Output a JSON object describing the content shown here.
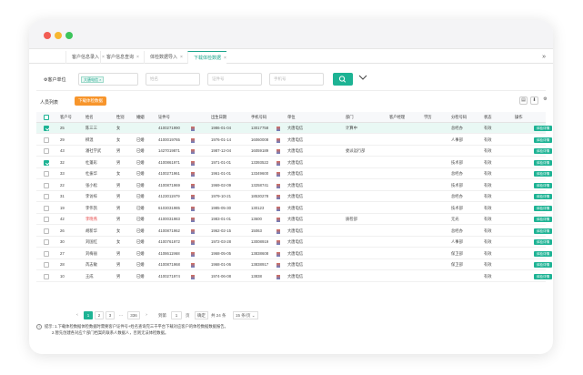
{
  "tabs": [
    "客户信息录入",
    "客户信息查询",
    "体检数据导入",
    "下载体检数据"
  ],
  "active_tab": 3,
  "more_icon": "»",
  "filter": {
    "label": "客户单位",
    "chip": "大唐电信",
    "placeholders": [
      "姓名",
      "证件号",
      "手机号"
    ]
  },
  "toolbar": {
    "title": "人员列表",
    "button": "下载体检数据"
  },
  "columns": [
    "客户号",
    "姓名",
    "性别",
    "婚姻",
    "证件号",
    "出生日期",
    "手机号码",
    "单位",
    "部门",
    "客户经理",
    "学历",
    "分检号码",
    "状态",
    "操作"
  ],
  "rows": [
    {
      "checked": true,
      "sel": true,
      "no": "25",
      "name": "陈三三",
      "sex": "女",
      "mar": "",
      "id": "4100271990",
      "idtail": "YBL",
      "birth": "1986-01-04",
      "phone": "13017758",
      "unit": "大唐电信",
      "dept": "计算中",
      "ctm": "",
      "edu": "",
      "split": "总经办",
      "status": "有效",
      "op": "体检详情"
    },
    {
      "checked": false,
      "sel": false,
      "no": "29",
      "name": "柳温",
      "sex": "女",
      "mar": "已婚",
      "id": "4100019765",
      "idtail": "",
      "birth": "1976-01-14",
      "phone": "16060008",
      "unit": "大唐电信",
      "dept": "",
      "ctm": "",
      "edu": "",
      "split": "人事部",
      "status": "有效",
      "op": "体检详情"
    },
    {
      "checked": false,
      "sel": false,
      "no": "43",
      "name": "潘社学武",
      "sex": "男",
      "mar": "已婚",
      "id": "1427019871",
      "idtail": "",
      "birth": "1987-12-04",
      "phone": "16059189",
      "unit": "大唐电信",
      "dept": "委派运行部",
      "ctm": "",
      "edu": "",
      "split": "",
      "status": "有效",
      "op": "体检详情"
    },
    {
      "checked": true,
      "sel": false,
      "no": "32",
      "name": "杜蓬彩",
      "sex": "男",
      "mar": "已婚",
      "id": "4100861971",
      "idtail": "",
      "birth": "1971-01-01",
      "phone": "13393522",
      "unit": "大唐电信",
      "dept": "",
      "ctm": "",
      "edu": "",
      "split": "技术部",
      "status": "有效",
      "op": "体检详情"
    },
    {
      "checked": false,
      "sel": false,
      "no": "33",
      "name": "杜振华",
      "sex": "女",
      "mar": "已婚",
      "id": "4100271961",
      "idtail": "",
      "birth": "1961-01-01",
      "phone": "13349600",
      "unit": "大唐电信",
      "dept": "",
      "ctm": "",
      "edu": "",
      "split": "总经办",
      "status": "有效",
      "op": "体检详情"
    },
    {
      "checked": false,
      "sel": false,
      "no": "22",
      "name": "张小松",
      "sex": "男",
      "mar": "已婚",
      "id": "4100871969",
      "idtail": "",
      "birth": "1969-02-09",
      "phone": "13258741",
      "unit": "大唐电信",
      "dept": "",
      "ctm": "",
      "edu": "",
      "split": "技术部",
      "status": "有效",
      "op": "体检详情"
    },
    {
      "checked": false,
      "sel": false,
      "no": "31",
      "name": "李访梓",
      "sex": "男",
      "mar": "已婚",
      "id": "4123011979",
      "idtail": "",
      "birth": "1979-10-21",
      "phone": "18530278",
      "unit": "大唐电信",
      "dept": "",
      "ctm": "",
      "edu": "",
      "split": "总经办",
      "status": "有效",
      "op": "体检详情"
    },
    {
      "checked": false,
      "sel": false,
      "no": "19",
      "name": "李伟凯",
      "sex": "男",
      "mar": "已婚",
      "id": "6103031985",
      "idtail": "",
      "birth": "1985-05-30",
      "phone": "130123",
      "unit": "大唐电信",
      "dept": "",
      "ctm": "",
      "edu": "",
      "split": "技术部",
      "status": "有效",
      "op": "体检详情"
    },
    {
      "checked": false,
      "sel": false,
      "no": "42",
      "name": "李晓燕",
      "sex": "男",
      "mar": "已婚",
      "id": "4100031983",
      "idtail": "",
      "birth": "1983-01-01",
      "phone": "13600",
      "unit": "大唐电信",
      "dept": "质检部",
      "ctm": "",
      "edu": "",
      "split": "无光",
      "status": "有效",
      "op": "体检详情",
      "red": true
    },
    {
      "checked": false,
      "sel": false,
      "no": "26",
      "name": "胡新华",
      "sex": "女",
      "mar": "已婚",
      "id": "4100871962",
      "idtail": "",
      "birth": "1962-02-15",
      "phone": "15063",
      "unit": "大唐电信",
      "dept": "",
      "ctm": "",
      "edu": "",
      "split": "总经办",
      "status": "有效",
      "op": "体检详情"
    },
    {
      "checked": false,
      "sel": false,
      "no": "30",
      "name": "刘国红",
      "sex": "女",
      "mar": "已婚",
      "id": "4100761972",
      "idtail": "",
      "birth": "1972-03-28",
      "phone": "13008919",
      "unit": "大唐电信",
      "dept": "",
      "ctm": "",
      "edu": "",
      "split": "人事部",
      "status": "有效",
      "op": "体检详情"
    },
    {
      "checked": false,
      "sel": false,
      "no": "27",
      "name": "刘梅丽",
      "sex": "男",
      "mar": "已婚",
      "id": "4108611968",
      "idtail": "",
      "birth": "1968-05-05",
      "phone": "13838608",
      "unit": "大唐电信",
      "dept": "",
      "ctm": "",
      "edu": "",
      "split": "保卫部",
      "status": "有效",
      "op": "体检详情"
    },
    {
      "checked": false,
      "sel": false,
      "no": "28",
      "name": "芮志敏",
      "sex": "男",
      "mar": "已婚",
      "id": "4100871968",
      "idtail": "",
      "birth": "1968-01-06",
      "phone": "13838917",
      "unit": "大唐电信",
      "dept": "",
      "ctm": "",
      "edu": "",
      "split": "保卫部",
      "status": "有效",
      "op": "体检详情"
    },
    {
      "checked": false,
      "sel": false,
      "no": "10",
      "name": "王成",
      "sex": "男",
      "mar": "已婚",
      "id": "4100271974",
      "idtail": "",
      "birth": "1974-06-08",
      "phone": "13838",
      "unit": "大唐电信",
      "dept": "",
      "ctm": "",
      "edu": "",
      "split": "",
      "status": "有效",
      "op": "体检详情"
    }
  ],
  "pager": {
    "prev": "‹",
    "pages": [
      "1",
      "2",
      "3"
    ],
    "ellipsis": "…",
    "last": "336",
    "next": "›",
    "goto": "到第",
    "page_input": "1",
    "unit": "页",
    "confirm": "确定",
    "total": "共 24 条",
    "size": "15 条/页"
  },
  "notes": {
    "line1": "提示: 1.下载体检数据体检数据时需要客户证件号+姓名查询完三千平台下载对应客户的体检数据数据报告。",
    "line2": "2.暂先创建各对应个部门档案的联系人数据人，否则无法体检数据。"
  }
}
